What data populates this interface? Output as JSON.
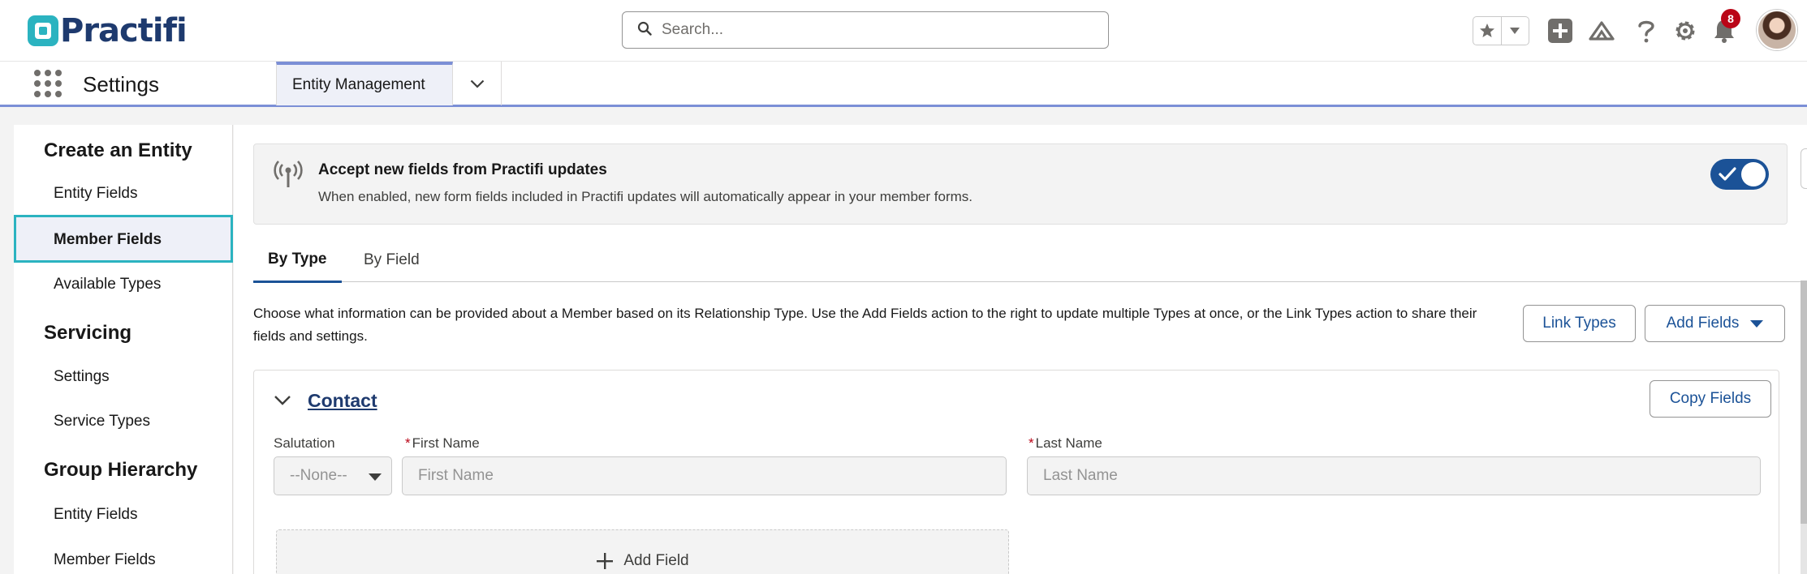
{
  "header": {
    "logo_text": "Practifi",
    "search_placeholder": "Search...",
    "notifications_count": "8"
  },
  "context_bar": {
    "app_name": "Settings",
    "tabs": [
      {
        "label": "Entity Management"
      }
    ]
  },
  "sidebar": {
    "sections": [
      {
        "heading": "Create an Entity",
        "items": [
          "Entity Fields",
          "Member Fields",
          "Available Types"
        ]
      },
      {
        "heading": "Servicing",
        "items": [
          "Settings",
          "Service Types"
        ]
      },
      {
        "heading": "Group Hierarchy",
        "items": [
          "Entity Fields",
          "Member Fields"
        ]
      }
    ],
    "active_item": "Member Fields"
  },
  "banner": {
    "title": "Accept new fields from Practifi updates",
    "description": "When enabled, new form fields included in Practifi updates will automatically appear in your member forms.",
    "toggle_on": true
  },
  "tabs": [
    {
      "label": "By Type",
      "active": true
    },
    {
      "label": "By Field",
      "active": false
    }
  ],
  "description": "Choose what information can be provided about a Member based on its Relationship Type. Use the Add Fields action to the right to update multiple Types at once, or the Link Types action to share their fields and settings.",
  "buttons": {
    "link_types": "Link Types",
    "add_fields": "Add Fields",
    "copy_fields": "Copy Fields"
  },
  "card": {
    "title": "Contact",
    "fields": {
      "salutation": {
        "label": "Salutation",
        "value": "--None--"
      },
      "first_name": {
        "label": "First Name",
        "placeholder": "First Name",
        "required": true
      },
      "last_name": {
        "label": "Last Name",
        "placeholder": "Last Name",
        "required": true
      }
    },
    "add_field_label": "Add Field"
  },
  "colors": {
    "brand": "#1e3a6e",
    "accent": "#2bb3c0",
    "primary": "#1b5297",
    "error": "#ba0517"
  }
}
